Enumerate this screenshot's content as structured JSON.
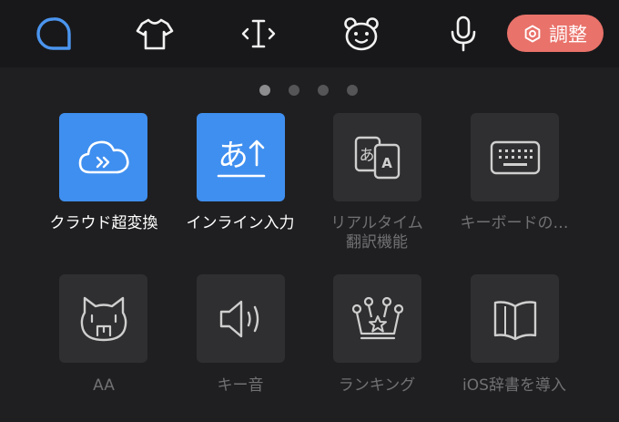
{
  "toolbar": {
    "icons": [
      "search-icon",
      "shirt-icon",
      "cursor-icon",
      "bear-face-icon",
      "microphone-icon"
    ],
    "adjust_label": "調整",
    "accent": "#3f8ff0",
    "adjust_color": "#e9726a"
  },
  "pager": {
    "total": 4,
    "active_index": 0
  },
  "grid": {
    "items": [
      {
        "label": "クラウド超変換",
        "icon": "cloud-arrows-icon",
        "active": true
      },
      {
        "label": "インライン入力",
        "icon": "hiragana-a-arrow-icon",
        "active": true
      },
      {
        "label_line1": "リアルタイム",
        "label_line2": "翻訳機能",
        "icon": "translate-icon",
        "active": false
      },
      {
        "label": "キーボードの…",
        "icon": "keyboard-icon",
        "active": false
      },
      {
        "label": "AA",
        "icon": "ascii-art-cat-icon",
        "active": false
      },
      {
        "label": "キー音",
        "icon": "speaker-icon",
        "active": false
      },
      {
        "label": "ランキング",
        "icon": "crown-icon",
        "active": false
      },
      {
        "label": "iOS辞書を導入",
        "icon": "book-icon",
        "active": false
      }
    ]
  }
}
